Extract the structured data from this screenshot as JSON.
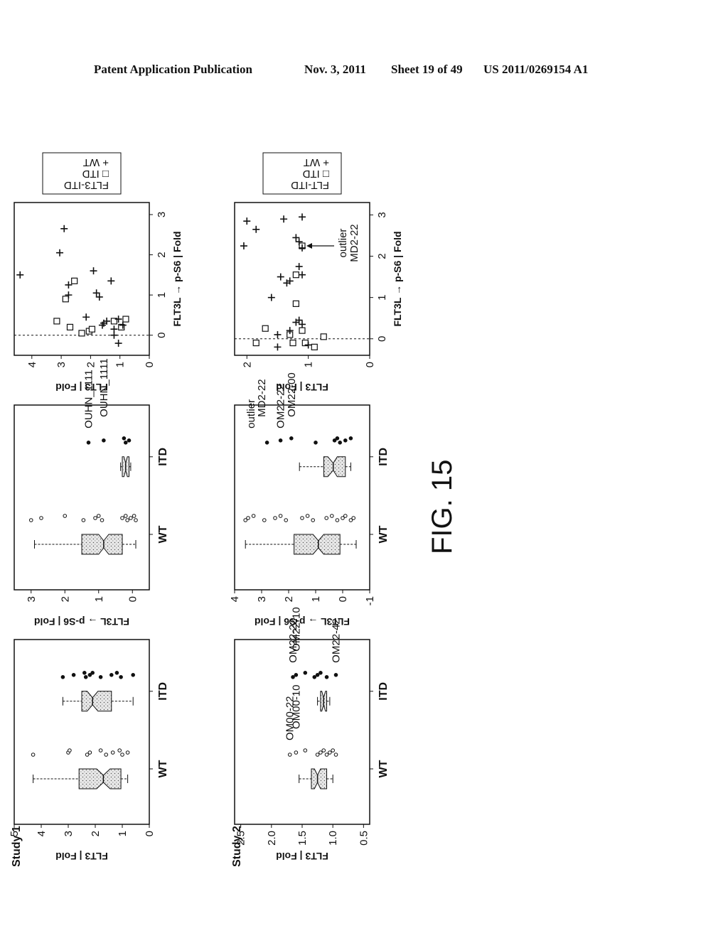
{
  "header": {
    "publication": "Patent Application Publication",
    "date": "Nov. 3, 2011",
    "sheet": "Sheet 19 of 49",
    "number": "US 2011/0269154 A1"
  },
  "figure_label": "FIG. 15",
  "chart_data": [
    {
      "id": "s1_flt3_box",
      "study": "Study 1",
      "type": "box",
      "categories": [
        "WT",
        "ITD"
      ],
      "ylabel": "FLT3 | Fold",
      "ylim": [
        0,
        5
      ],
      "yticks": [
        "0",
        "1",
        "2",
        "3",
        "4",
        "5"
      ],
      "boxes": [
        {
          "name": "WT",
          "min": 0.8,
          "q1": 1.05,
          "median": 1.7,
          "q3": 2.6,
          "max": 4.3,
          "notch": [
            1.45,
            1.95
          ]
        },
        {
          "name": "ITD",
          "min": 0.6,
          "q1": 1.4,
          "median": 2.1,
          "q3": 2.5,
          "max": 3.2,
          "notch": [
            1.9,
            2.3
          ]
        }
      ],
      "points": [
        {
          "group": "WT",
          "style": "open",
          "values": [
            4.3,
            3.0,
            2.95,
            2.3,
            2.2,
            1.8,
            1.6,
            1.35,
            1.1,
            1.0,
            0.8
          ]
        },
        {
          "group": "ITD",
          "style": "filled",
          "values": [
            3.2,
            2.8,
            2.4,
            2.35,
            2.2,
            2.1,
            1.8,
            1.4,
            1.2,
            1.05,
            0.6
          ]
        }
      ],
      "annotations": []
    },
    {
      "id": "s1_ps6_box",
      "study": "Study 1",
      "type": "box",
      "categories": [
        "WT",
        "ITD"
      ],
      "ylabel": "FLT3L → p-S6 | Fold",
      "ylim": [
        -0.5,
        3.5
      ],
      "yticks": [
        "0",
        "1",
        "2",
        "3"
      ],
      "boxes": [
        {
          "name": "WT",
          "min": -0.1,
          "q1": 0.3,
          "median": 0.85,
          "q3": 1.5,
          "max": 2.9,
          "notch": [
            0.7,
            1.0
          ]
        },
        {
          "name": "ITD",
          "min": 0.05,
          "q1": 0.1,
          "median": 0.2,
          "q3": 0.3,
          "max": 0.35,
          "notch": [
            0.15,
            0.25
          ]
        }
      ],
      "points": [
        {
          "group": "WT",
          "style": "open",
          "values": [
            3.0,
            2.7,
            2.0,
            1.45,
            1.1,
            1.0,
            0.9,
            0.3,
            0.2,
            0.15,
            0.05,
            -0.05,
            -0.1
          ]
        },
        {
          "group": "ITD",
          "style": "filled",
          "values": [
            1.3,
            0.85,
            0.25,
            0.2,
            0.1
          ]
        }
      ],
      "annotations": [
        {
          "text": "OUHN_1111",
          "group": "ITD",
          "value": 1.3
        },
        {
          "text": "OUHN_1111",
          "group": "ITD",
          "value": 0.85
        }
      ]
    },
    {
      "id": "s1_scatter",
      "study": "Study 1",
      "type": "scatter",
      "xlabel": "FLT3L → p-S6 | Fold",
      "ylabel": "FLT3 | Fold",
      "xlim": [
        -0.5,
        3.3
      ],
      "ylim": [
        0,
        4.6
      ],
      "xticks": [
        "0",
        "1",
        "2",
        "3"
      ],
      "yticks": [
        "0",
        "1",
        "2",
        "3",
        "4"
      ],
      "vline_x": 0,
      "legend": {
        "title": "FLT3-ITD",
        "entries": [
          {
            "symbol": "square",
            "label": "ITD"
          },
          {
            "symbol": "plus",
            "label": "WT"
          }
        ]
      },
      "series": [
        {
          "name": "ITD",
          "symbol": "square",
          "points": [
            [
              0.35,
              3.15
            ],
            [
              0.2,
              2.7
            ],
            [
              0.9,
              2.85
            ],
            [
              1.35,
              2.55
            ],
            [
              0.05,
              2.3
            ],
            [
              0.1,
              2.05
            ],
            [
              0.35,
              1.2
            ],
            [
              0.2,
              0.95
            ],
            [
              0.4,
              0.8
            ],
            [
              0.15,
              1.95
            ]
          ]
        },
        {
          "name": "WT",
          "symbol": "plus",
          "points": [
            [
              1.5,
              4.4
            ],
            [
              2.05,
              3.05
            ],
            [
              2.65,
              2.9
            ],
            [
              1.0,
              2.75
            ],
            [
              1.25,
              2.75
            ],
            [
              1.6,
              1.9
            ],
            [
              0.95,
              1.7
            ],
            [
              1.05,
              1.8
            ],
            [
              1.35,
              1.3
            ],
            [
              0.45,
              2.15
            ],
            [
              0.3,
              1.55
            ],
            [
              0.25,
              1.6
            ],
            [
              0.35,
              1.45
            ],
            [
              -0.2,
              1.05
            ],
            [
              0.0,
              1.2
            ],
            [
              0.15,
              1.2
            ],
            [
              0.4,
              1.05
            ],
            [
              0.25,
              0.9
            ]
          ]
        }
      ]
    },
    {
      "id": "s2_flt3_box",
      "study": "Study 2",
      "type": "box",
      "categories": [
        "WT",
        "ITD"
      ],
      "ylabel": "FLT3 | Fold",
      "ylim": [
        0.4,
        2.6
      ],
      "yticks": [
        "0.5",
        "1.0",
        "1.5",
        "2.0",
        "2.5"
      ],
      "boxes": [
        {
          "name": "WT",
          "min": 1.0,
          "q1": 1.1,
          "median": 1.25,
          "q3": 1.35,
          "max": 1.55,
          "notch": [
            1.2,
            1.3
          ]
        },
        {
          "name": "ITD",
          "min": 1.05,
          "q1": 1.1,
          "median": 1.15,
          "q3": 1.2,
          "max": 1.25,
          "notch": [
            1.12,
            1.18
          ]
        }
      ],
      "points": [
        {
          "group": "WT",
          "style": "open",
          "values": [
            1.7,
            1.6,
            1.45,
            1.25,
            1.2,
            1.15,
            1.1,
            1.05,
            1.0,
            0.95
          ]
        },
        {
          "group": "ITD",
          "style": "filled",
          "values": [
            1.65,
            1.6,
            1.45,
            1.3,
            1.25,
            1.2,
            1.1,
            0.95
          ]
        }
      ],
      "annotations": [
        {
          "text": "OM00-22",
          "group": "WT",
          "value": 1.7
        },
        {
          "text": "OM00-10",
          "group": "WT",
          "value": 1.6
        },
        {
          "text": "OM22-22",
          "group": "ITD",
          "value": 1.65
        },
        {
          "text": "OM22-10",
          "group": "ITD",
          "value": 1.6
        },
        {
          "text": "OM22-42",
          "group": "ITD",
          "value": 0.95
        }
      ]
    },
    {
      "id": "s2_ps6_box",
      "study": "Study 2",
      "type": "box",
      "categories": [
        "WT",
        "ITD"
      ],
      "ylabel": "FLT3L → p-S6 | Fold",
      "ylim": [
        -1,
        4
      ],
      "yticks": [
        "-1",
        "0",
        "1",
        "2",
        "3",
        "4"
      ],
      "boxes": [
        {
          "name": "WT",
          "min": -0.5,
          "q1": 0.1,
          "median": 0.9,
          "q3": 1.8,
          "max": 3.6,
          "notch": [
            0.7,
            1.1
          ]
        },
        {
          "name": "ITD",
          "min": -0.3,
          "q1": -0.1,
          "median": 0.35,
          "q3": 0.7,
          "max": 1.6,
          "notch": [
            0.2,
            0.55
          ]
        }
      ],
      "points": [
        {
          "group": "WT",
          "style": "open",
          "values": [
            3.6,
            3.5,
            3.3,
            2.9,
            2.5,
            2.3,
            2.1,
            1.5,
            1.3,
            1.1,
            0.6,
            0.4,
            0.2,
            0.0,
            -0.1,
            -0.3,
            -0.4
          ]
        },
        {
          "group": "ITD",
          "style": "filled",
          "values": [
            2.8,
            2.3,
            1.9,
            1.0,
            0.3,
            0.2,
            0.1,
            -0.1,
            -0.3
          ]
        }
      ],
      "annotations": [
        {
          "text": "outlier",
          "group": "ITD",
          "value": 3.4
        },
        {
          "text": "MD2-22",
          "group": "ITD",
          "value": 3.0
        },
        {
          "text": "OM22-22",
          "group": "ITD",
          "value": 2.3
        },
        {
          "text": "OM22-00",
          "group": "ITD",
          "value": 1.9
        }
      ]
    },
    {
      "id": "s2_scatter",
      "study": "Study 2",
      "type": "scatter",
      "xlabel": "FLT3L → p-S6 | Fold",
      "ylabel": "FLT3 | Fold",
      "xlim": [
        -0.4,
        3.3
      ],
      "ylim": [
        0,
        2.2
      ],
      "xticks": [
        "0",
        "1",
        "2",
        "3"
      ],
      "yticks": [
        "0",
        "1",
        "2"
      ],
      "vline_x": 0,
      "legend": {
        "title": "FLT-ITD",
        "entries": [
          {
            "symbol": "square",
            "label": "ITD"
          },
          {
            "symbol": "plus",
            "label": "WT"
          }
        ]
      },
      "series": [
        {
          "name": "ITD",
          "symbol": "square",
          "points": [
            [
              -0.1,
              1.85
            ],
            [
              0.25,
              1.7
            ],
            [
              0.1,
              1.3
            ],
            [
              -0.1,
              1.25
            ],
            [
              -0.1,
              1.05
            ],
            [
              0.05,
              0.75
            ],
            [
              0.2,
              1.1
            ],
            [
              -0.2,
              0.9
            ],
            [
              0.85,
              1.2
            ],
            [
              1.55,
              1.2
            ],
            [
              2.25,
              1.1
            ]
          ]
        },
        {
          "name": "WT",
          "symbol": "plus",
          "points": [
            [
              2.25,
              2.05
            ],
            [
              2.85,
              2.0
            ],
            [
              2.65,
              1.85
            ],
            [
              2.9,
              1.4
            ],
            [
              2.95,
              1.1
            ],
            [
              2.45,
              1.2
            ],
            [
              2.35,
              1.15
            ],
            [
              2.2,
              1.1
            ],
            [
              1.75,
              1.15
            ],
            [
              1.5,
              1.45
            ],
            [
              1.35,
              1.35
            ],
            [
              1.4,
              1.3
            ],
            [
              1.55,
              1.1
            ],
            [
              1.0,
              1.6
            ],
            [
              0.4,
              1.2
            ],
            [
              0.45,
              1.15
            ],
            [
              0.35,
              1.1
            ],
            [
              0.1,
              1.5
            ],
            [
              0.2,
              1.3
            ],
            [
              -0.2,
              1.5
            ],
            [
              -0.15,
              1.0
            ]
          ]
        }
      ],
      "annotations": [
        {
          "text": "outlier",
          "x": 2.25,
          "y": 1.1
        },
        {
          "text": "MD2-22",
          "x": 2.25,
          "y": 1.1
        }
      ]
    }
  ]
}
